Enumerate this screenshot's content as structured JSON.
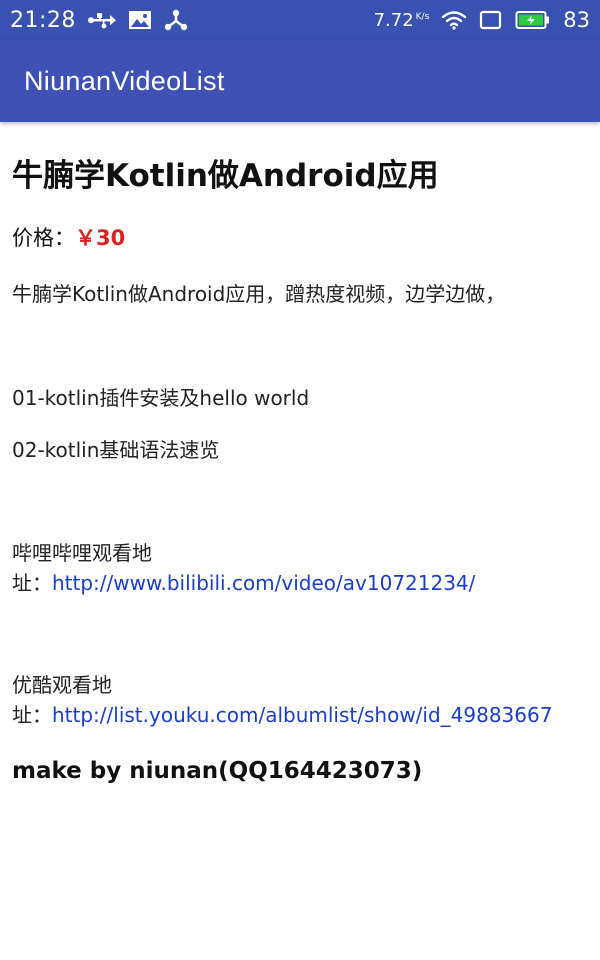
{
  "status_bar": {
    "time": "21:28",
    "network_speed": "7.72",
    "network_unit": "K/s",
    "battery_level": "83",
    "icons_left": [
      "usb-icon",
      "image-icon",
      "share-icon"
    ],
    "icons_right": [
      "wifi-icon",
      "screen-icon",
      "battery-icon"
    ]
  },
  "app_bar": {
    "title": "NiunanVideoList",
    "color": "#3f51b5"
  },
  "course": {
    "title": "牛腩学Kotlin做Android应用",
    "price_label": "价格：",
    "price_value": "￥30",
    "price_color": "#e02020",
    "description": "牛腩学Kotlin做Android应用，蹭热度视频，边学边做，",
    "episodes": [
      "01-kotlin插件安装及hello world",
      "02-kotlin基础语法速览"
    ],
    "bilibili": {
      "label_line1": "哔哩哔哩观看地",
      "label_line2": "址：",
      "url": "http://www.bilibili.com/video/av10721234/"
    },
    "youku": {
      "label_line1": "优酷观看地",
      "label_line2": "址：",
      "url": "http://list.youku.com/albumlist/show/id_49883667"
    },
    "credit": "make by niunan(QQ164423073)"
  },
  "link_color": "#1a3ec8"
}
